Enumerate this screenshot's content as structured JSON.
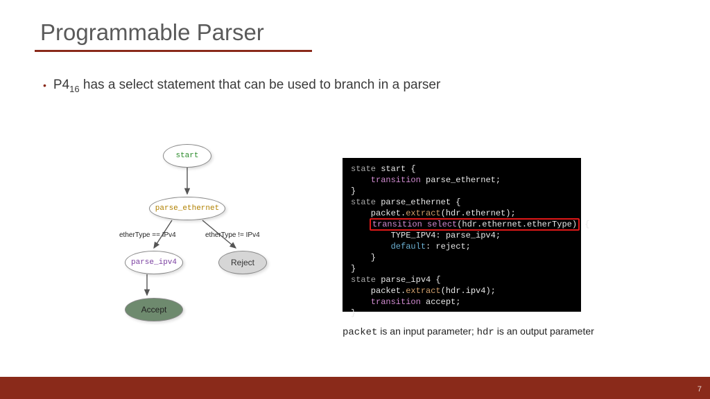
{
  "title": "Programmable Parser",
  "bullet": {
    "prefix": "P4",
    "sub": "16",
    "rest": " has a select statement that can be used to branch in a parser"
  },
  "flow": {
    "start": "start",
    "parse_ethernet": "parse_ethernet",
    "parse_ipv4": "parse_ipv4",
    "reject": "Reject",
    "accept": "Accept",
    "edge_left": "etherType == IPv4",
    "edge_right": "etherType != IPv4"
  },
  "code": {
    "l1a": "state ",
    "l1b": "start {",
    "l2a": "    transition ",
    "l2b": "parse_ethernet;",
    "l3": "}",
    "l4a": "state ",
    "l4b": "parse_ethernet {",
    "l5a": "    packet.",
    "l5b": "extract",
    "l5c": "(hdr.ethernet);",
    "l6a": "    ",
    "l6hi_a": "transition select",
    "l6hi_b": "(hdr.ethernet.etherType)",
    "l6b": " {",
    "l7": "        TYPE_IPV4: parse_ipv4;",
    "l8a": "        ",
    "l8b": "default",
    "l8c": ": reject;",
    "l9": "    }",
    "l10": "}",
    "l11a": "state ",
    "l11b": "parse_ipv4 {",
    "l12a": "    packet.",
    "l12b": "extract",
    "l12c": "(hdr.ipv4);",
    "l13a": "    transition ",
    "l13b": "accept;",
    "l14": "}"
  },
  "caption": {
    "c1": "packet",
    "c2": " is an input parameter; ",
    "c3": "hdr",
    "c4": " is an output parameter"
  },
  "page": "7"
}
